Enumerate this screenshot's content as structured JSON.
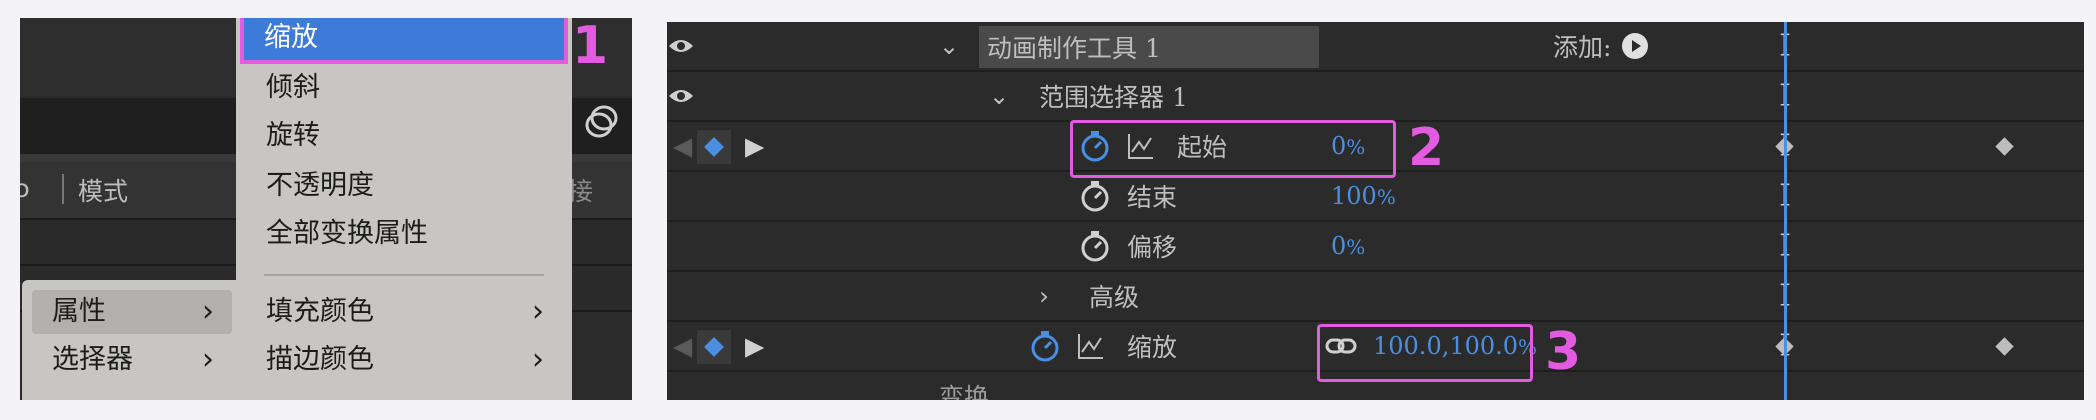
{
  "left": {
    "column_mode_label": "模式",
    "column_partial_label": "接",
    "context_menu": {
      "items": [
        {
          "label": "缩放",
          "highlighted": true
        },
        {
          "label": "倾斜"
        },
        {
          "label": "旋转"
        },
        {
          "label": "不透明度"
        },
        {
          "label": "全部变换属性"
        },
        {
          "label": "填充颜色",
          "submenu": true
        },
        {
          "label": "描边颜色",
          "submenu": true
        }
      ]
    },
    "parent_menu": {
      "items": [
        {
          "label": "属性",
          "submenu": true,
          "active": true
        },
        {
          "label": "选择器",
          "submenu": true
        }
      ]
    },
    "callout": "1"
  },
  "right": {
    "rows": [
      {
        "label": "动画制作工具 1",
        "add_label": "添加:"
      },
      {
        "label": "范围选择器 1"
      },
      {
        "label": "起始",
        "value": "0",
        "unit": "%"
      },
      {
        "label": "结束",
        "value": "100",
        "unit": "%"
      },
      {
        "label": "偏移",
        "value": "0",
        "unit": "%"
      },
      {
        "label": "高级"
      },
      {
        "label": "缩放",
        "value": "100.0,100.0",
        "unit": "%"
      },
      {
        "label": "变换"
      }
    ],
    "callout_2": "2",
    "callout_3": "3"
  },
  "colors": {
    "accent_pink": "#e35be0",
    "value_blue": "#4b8fe3",
    "menu_highlight": "#3d7bd9",
    "panel_bg": "#2b2b2b"
  }
}
